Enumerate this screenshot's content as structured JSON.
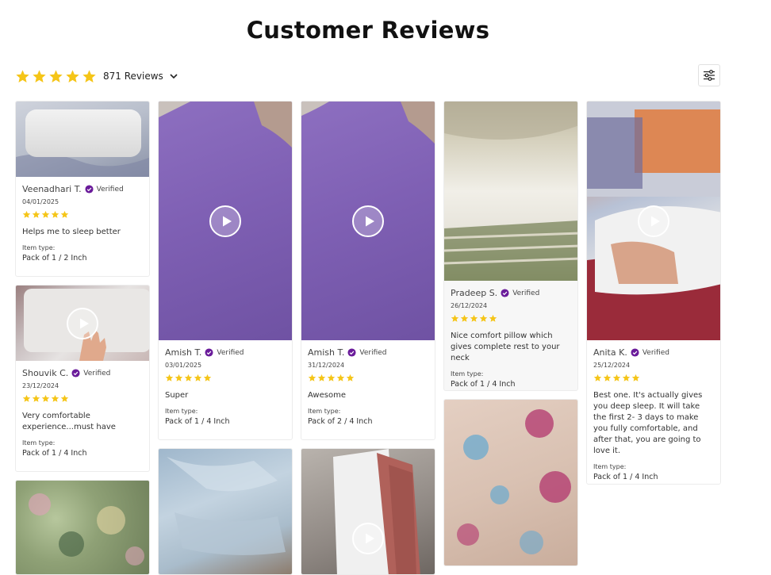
{
  "page": {
    "title": "Customer Reviews"
  },
  "summary": {
    "rating": 5,
    "reviews_label": "871 Reviews"
  },
  "colors": {
    "star": "#f5c518",
    "verified": "#6a1b9a",
    "accent": "#7a4fb0"
  },
  "icons": {
    "filter": "sliders-icon",
    "play": "play-icon",
    "verified": "check-badge-icon",
    "sort": "chevron-down-icon"
  },
  "labels": {
    "verified": "Verified",
    "item_type": "Item type:"
  },
  "reviews": [
    {
      "name": "Veenadhari T.",
      "date": "04/01/2025",
      "rating": 5,
      "text": "Helps me to sleep better",
      "item": "Pack of 1 / 2 Inch"
    },
    {
      "name": "Shouvik C.",
      "date": "23/12/2024",
      "rating": 5,
      "text": "Very comfortable experience...must have",
      "item": "Pack of 1 / 4 Inch"
    },
    {
      "name": "Amish T.",
      "date": "03/01/2025",
      "rating": 5,
      "text": "Super",
      "item": "Pack of 1 / 4 Inch"
    },
    {
      "name": "Amish T.",
      "date": "31/12/2024",
      "rating": 5,
      "text": "Awesome",
      "item": "Pack of 2 / 4 Inch"
    },
    {
      "name": "Pradeep S.",
      "date": "26/12/2024",
      "rating": 5,
      "text": "Nice comfort pillow which gives complete rest to your neck",
      "item": "Pack of 1 / 4 Inch"
    },
    {
      "name": "Anita K.",
      "date": "25/12/2024",
      "rating": 5,
      "text": "Best one. It's actually gives you deep sleep.  It will take the first 2- 3 days  to make you fully comfortable, and after that, you are going to love it.",
      "item": "Pack of 1 / 4 Inch"
    }
  ]
}
